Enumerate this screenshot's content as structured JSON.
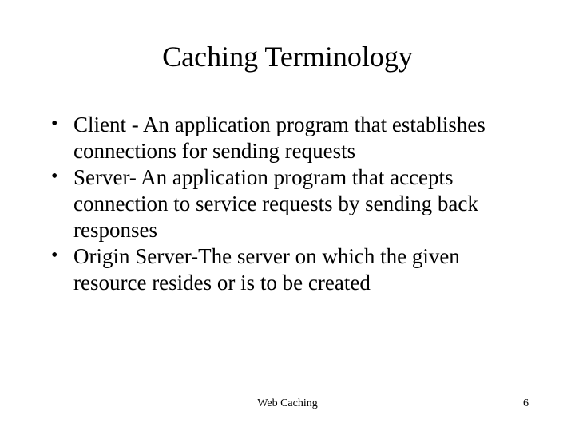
{
  "title": "Caching Terminology",
  "bullets": [
    "Client - An application program that establishes connections for sending requests",
    "Server- An application program that accepts connection to service requests by sending back responses",
    "Origin Server-The server on which the given resource resides or is to be created"
  ],
  "footer": {
    "center": "Web  Caching",
    "page": "6"
  }
}
